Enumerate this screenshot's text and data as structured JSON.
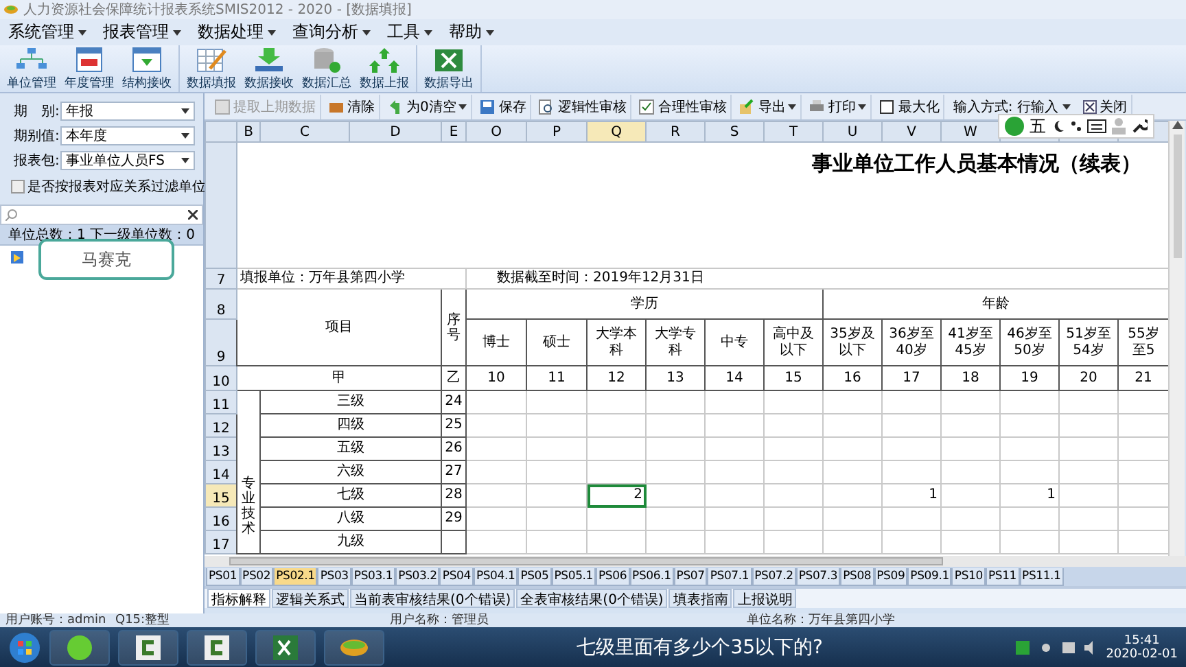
{
  "window": {
    "title": "人力资源社会保障统计报表系统SMIS2012 - 2020 - [数据填报]"
  },
  "menu": [
    {
      "label": "系统管理"
    },
    {
      "label": "报表管理"
    },
    {
      "label": "数据处理"
    },
    {
      "label": "查询分析"
    },
    {
      "label": "工具"
    },
    {
      "label": "帮助"
    }
  ],
  "toolbar_groups": [
    [
      {
        "label": "单位管理",
        "kind": "org"
      },
      {
        "label": "年度管理",
        "kind": "year"
      },
      {
        "label": "结构接收",
        "kind": "receive"
      }
    ],
    [
      {
        "label": "数据填报",
        "kind": "fill"
      },
      {
        "label": "数据接收",
        "kind": "import"
      },
      {
        "label": "数据汇总",
        "kind": "sum"
      },
      {
        "label": "数据上报",
        "kind": "upload"
      }
    ],
    [
      {
        "label": "数据导出",
        "kind": "export"
      }
    ]
  ],
  "left_panel": {
    "fields": [
      {
        "label": "期　别:",
        "value": "年报"
      },
      {
        "label": "期别值:",
        "value": "本年度"
      },
      {
        "label": "报表包:",
        "value": "事业单位人员FS"
      }
    ],
    "filter_checkbox": {
      "label": "是否按报表对应关系过滤单位",
      "checked": false
    },
    "unit_count": "单位总数：1  下一级单位数：0",
    "popup": "马赛克"
  },
  "sheet_toolbar": [
    {
      "label": "提取上期数据",
      "kind": "doc",
      "disabled": true,
      "dropdown": false
    },
    {
      "label": "清除",
      "kind": "clear",
      "disabled": false,
      "dropdown": false
    },
    {
      "label": "为0清空",
      "kind": "undo",
      "disabled": false,
      "dropdown": true
    },
    {
      "label": "保存",
      "kind": "save",
      "disabled": false,
      "dropdown": false
    },
    {
      "label": "逻辑性审核",
      "kind": "audit",
      "disabled": false,
      "dropdown": false
    },
    {
      "label": "合理性审核",
      "kind": "check",
      "disabled": false,
      "dropdown": false
    },
    {
      "label": "导出",
      "kind": "export",
      "disabled": false,
      "dropdown": true
    },
    {
      "label": "打印",
      "kind": "print",
      "disabled": false,
      "dropdown": true
    },
    {
      "label": "最大化",
      "kind": "maximize",
      "disabled": false,
      "dropdown": false
    }
  ],
  "input_mode": {
    "label": "输入方式:",
    "value": "行输入"
  },
  "close_button": {
    "label": "关闭"
  },
  "ime_toolbar": {
    "mode": "五"
  },
  "sheet": {
    "label_columns": [
      {
        "letter": "B",
        "selected": false
      },
      {
        "letter": "C",
        "selected": false
      },
      {
        "letter": "D",
        "selected": false
      },
      {
        "letter": "E",
        "selected": false
      }
    ],
    "value_columns": [
      {
        "letter": "O",
        "selected": false
      },
      {
        "letter": "P",
        "selected": false
      },
      {
        "letter": "Q",
        "selected": true
      },
      {
        "letter": "R",
        "selected": false
      },
      {
        "letter": "S",
        "selected": false
      },
      {
        "letter": "T",
        "selected": false
      },
      {
        "letter": "U",
        "selected": false
      },
      {
        "letter": "V",
        "selected": false
      },
      {
        "letter": "W",
        "selected": false
      }
    ],
    "title": "事业单位工作人员基本情况（续表）",
    "info_row": {
      "number": "7",
      "unit": "填报单位：万年县第四小学",
      "date": "数据截至时间：2019年12月31日"
    },
    "header": {
      "rows": [
        "8",
        "9",
        "10"
      ],
      "item": "项目",
      "seq": "序号",
      "item_code": "甲",
      "seq_code": "乙",
      "groups": [
        {
          "label": "学历",
          "columns": [
            "博士",
            "硕士",
            "大学本科",
            "大学专科",
            "中专",
            "高中及以下"
          ]
        },
        {
          "label": "年龄",
          "columns": [
            "35岁及以下",
            "36岁至40岁",
            "41岁至45岁",
            "46岁至50岁",
            "51岁至54岁",
            "55岁至5"
          ]
        }
      ],
      "codes": [
        "10",
        "11",
        "12",
        "13",
        "14",
        "15",
        "16",
        "17",
        "18",
        "19",
        "20",
        "21"
      ]
    },
    "group_label": "专业技术",
    "rows": [
      {
        "number": "11",
        "label": "三级",
        "seq": "24",
        "selected": false,
        "cells": [
          null,
          null,
          null,
          null,
          null,
          null,
          null,
          null,
          null,
          null,
          null,
          null
        ]
      },
      {
        "number": "12",
        "label": "四级",
        "seq": "25",
        "selected": false,
        "cells": [
          null,
          null,
          null,
          null,
          null,
          null,
          null,
          null,
          null,
          null,
          null,
          null
        ]
      },
      {
        "number": "13",
        "label": "五级",
        "seq": "26",
        "selected": false,
        "cells": [
          null,
          null,
          null,
          null,
          null,
          null,
          null,
          null,
          null,
          null,
          null,
          null
        ]
      },
      {
        "number": "14",
        "label": "六级",
        "seq": "27",
        "selected": false,
        "cells": [
          null,
          null,
          null,
          null,
          null,
          null,
          null,
          null,
          null,
          null,
          null,
          null
        ]
      },
      {
        "number": "15",
        "label": "七级",
        "seq": "28",
        "selected": true,
        "cells": [
          null,
          null,
          {
            "value": "2",
            "selected": true
          },
          null,
          null,
          null,
          null,
          {
            "value": "1",
            "selected": false
          },
          null,
          {
            "value": "1",
            "selected": false
          },
          null,
          null
        ]
      },
      {
        "number": "16",
        "label": "八级",
        "seq": "29",
        "selected": false,
        "cells": [
          null,
          null,
          null,
          null,
          null,
          null,
          null,
          null,
          null,
          null,
          null,
          null
        ]
      },
      {
        "number": "17",
        "label": "九级",
        "selected": false,
        "cells": [
          null,
          null,
          null,
          null,
          null,
          null,
          null,
          null,
          null,
          null,
          null,
          null
        ]
      }
    ]
  },
  "sheet_tabs": [
    {
      "label": "PS01",
      "selected": false
    },
    {
      "label": "PS02",
      "selected": false
    },
    {
      "label": "PS02.1",
      "selected": true
    },
    {
      "label": "PS03",
      "selected": false
    },
    {
      "label": "PS03.1",
      "selected": false
    },
    {
      "label": "PS03.2",
      "selected": false
    },
    {
      "label": "PS04",
      "selected": false
    },
    {
      "label": "PS04.1",
      "selected": false
    },
    {
      "label": "PS05",
      "selected": false
    },
    {
      "label": "PS05.1",
      "selected": false
    },
    {
      "label": "PS06",
      "selected": false
    },
    {
      "label": "PS06.1",
      "selected": false
    },
    {
      "label": "PS07",
      "selected": false
    },
    {
      "label": "PS07.1",
      "selected": false
    },
    {
      "label": "PS07.2",
      "selected": false
    },
    {
      "label": "PS07.3",
      "selected": false
    },
    {
      "label": "PS08",
      "selected": false
    },
    {
      "label": "PS09",
      "selected": false
    },
    {
      "label": "PS09.1",
      "selected": false
    },
    {
      "label": "PS10",
      "selected": false
    },
    {
      "label": "PS11",
      "selected": false
    },
    {
      "label": "PS11.1",
      "selected": false
    }
  ],
  "bottom_tabs": [
    {
      "label": "指标解释",
      "selected": true
    },
    {
      "label": "逻辑关系式",
      "selected": false
    },
    {
      "label": "当前表审核结果(0个错误)",
      "selected": false
    },
    {
      "label": "全表审核结果(0个错误)",
      "selected": false
    },
    {
      "label": "填表指南",
      "selected": false
    },
    {
      "label": "上报说明",
      "selected": false
    }
  ],
  "status_bar": [
    "用户账号：admin",
    "Q15:整型",
    "用户名称：管理员",
    "单位名称：万年县第四小学"
  ],
  "taskbar": {
    "apps": [
      {
        "kind": "browser"
      },
      {
        "kind": "recorder"
      },
      {
        "kind": "recorder"
      },
      {
        "kind": "excel"
      },
      {
        "kind": "leaf"
      }
    ],
    "subtitle": "七级里面有多少个35以下的?",
    "time": "15:41",
    "date": "2020-02-01"
  }
}
